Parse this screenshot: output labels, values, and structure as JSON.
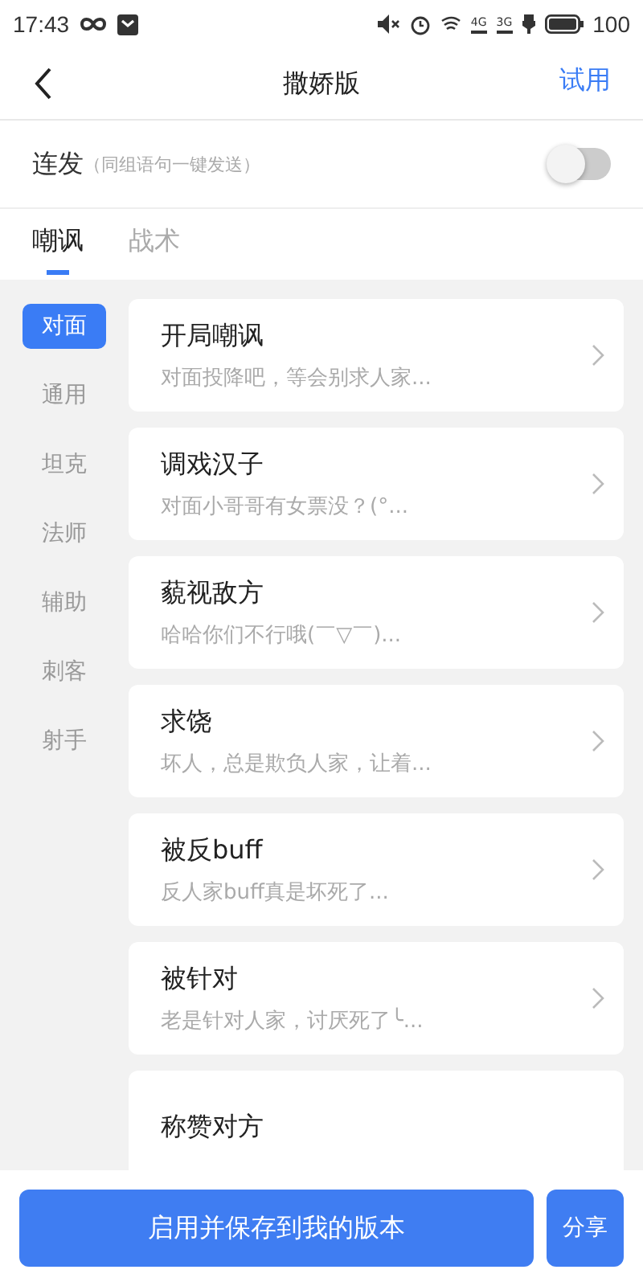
{
  "status_bar": {
    "time": "17:43",
    "signals": [
      "4G",
      "3G"
    ],
    "battery": "100"
  },
  "header": {
    "title": "撒娇版",
    "action": "试用"
  },
  "burst": {
    "label": "连发",
    "hint": "（同组语句一键发送）",
    "on": false
  },
  "tabs": [
    {
      "label": "嘲讽",
      "selected": true
    },
    {
      "label": "战术",
      "selected": false
    }
  ],
  "sidebar": {
    "items": [
      {
        "label": "对面",
        "selected": true
      },
      {
        "label": "通用",
        "selected": false
      },
      {
        "label": "坦克",
        "selected": false
      },
      {
        "label": "法师",
        "selected": false
      },
      {
        "label": "辅助",
        "selected": false
      },
      {
        "label": "刺客",
        "selected": false
      },
      {
        "label": "射手",
        "selected": false
      }
    ]
  },
  "phrases": [
    {
      "title": "开局嘲讽",
      "preview": "对面投降吧，等会别求人家..."
    },
    {
      "title": "调戏汉子",
      "preview": "对面小哥哥有女票没？(°..."
    },
    {
      "title": "藐视敌方",
      "preview": "哈哈你们不行哦(￣▽￣)..."
    },
    {
      "title": "求饶",
      "preview": "坏人，总是欺负人家，让着..."
    },
    {
      "title": "被反buff",
      "preview": "反人家buff真是坏死了..."
    },
    {
      "title": "被针对",
      "preview": "老是针对人家，讨厌死了╰..."
    },
    {
      "title": "称赞对方"
    }
  ],
  "footer": {
    "primary": "启用并保存到我的版本",
    "secondary": "分享"
  }
}
